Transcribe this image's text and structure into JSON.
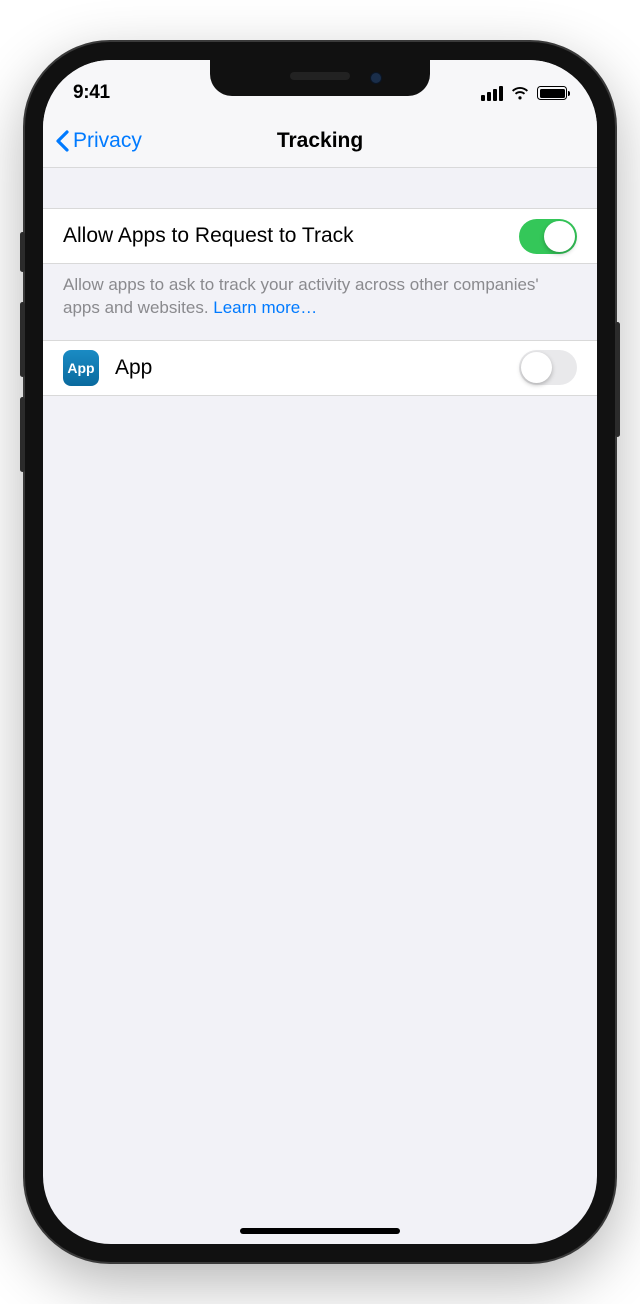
{
  "status": {
    "time": "9:41"
  },
  "nav": {
    "back_label": "Privacy",
    "title": "Tracking"
  },
  "settings": {
    "allow_tracking": {
      "label": "Allow Apps to Request to Track",
      "enabled": true
    },
    "footer_text": "Allow apps to ask to track your activity across other companies' apps and websites. ",
    "learn_more": "Learn more…",
    "apps": [
      {
        "icon_label": "App",
        "name": "App",
        "enabled": false
      }
    ]
  }
}
